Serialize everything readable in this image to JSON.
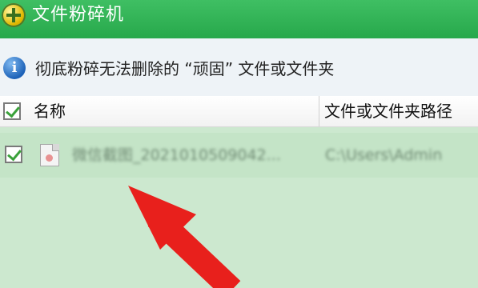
{
  "window": {
    "title": "文件粉碎机"
  },
  "info": {
    "text": "彻底粉碎无法删除的 “顽固” 文件或文件夹"
  },
  "table": {
    "columns": [
      {
        "label": "名称"
      },
      {
        "label": "文件或文件夹路径"
      }
    ],
    "rows": [
      {
        "checked": true,
        "name": "微信截图_2021010509042...",
        "path": "C:\\Users\\Admin"
      }
    ]
  },
  "colors": {
    "titlebar": "#2fb455",
    "list_background": "#cce8cf",
    "arrow": "#e8201c"
  },
  "icons": {
    "title": "plus-circle-icon",
    "info": "info-icon",
    "file": "image-file-icon",
    "pointer": "red-arrow-icon"
  }
}
